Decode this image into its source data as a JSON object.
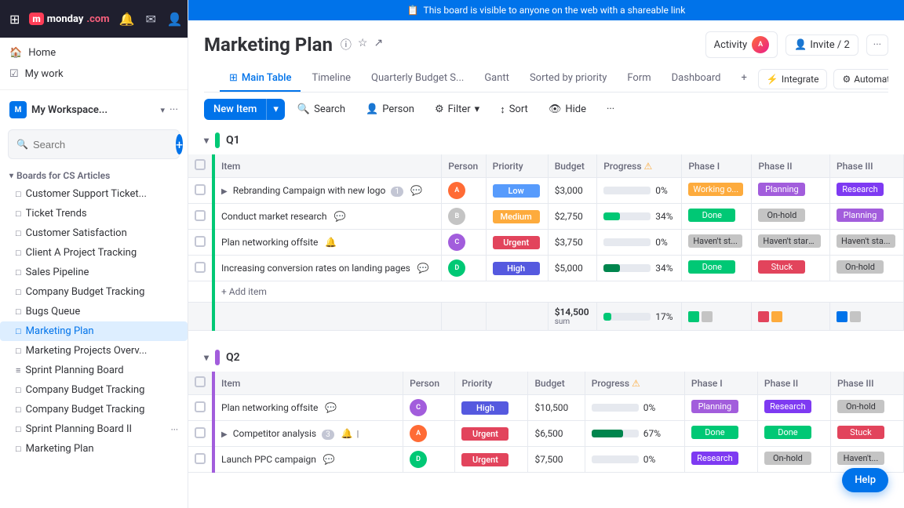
{
  "app": {
    "logo": "monday",
    "logo_short": "M",
    "top_nav_icons": [
      "grid-icon",
      "bell-icon",
      "message-icon",
      "person-icon",
      "diamond-icon",
      "lock-icon",
      "search-icon",
      "help-icon"
    ]
  },
  "sidebar": {
    "home_label": "Home",
    "mywork_label": "My work",
    "workspace_name": "My Workspace...",
    "search_placeholder": "Search",
    "boards_section_label": "Boards for CS Articles",
    "boards": [
      {
        "label": "Customer Support Ticket...",
        "active": false,
        "icon": "□"
      },
      {
        "label": "Ticket Trends",
        "active": false,
        "icon": "□"
      },
      {
        "label": "Customer Satisfaction",
        "active": false,
        "icon": "□"
      },
      {
        "label": "Client A Project Tracking",
        "active": false,
        "icon": "□"
      },
      {
        "label": "Sales Pipeline",
        "active": false,
        "icon": "□"
      },
      {
        "label": "Company Budget Tracking",
        "active": false,
        "icon": "□"
      },
      {
        "label": "Bugs Queue",
        "active": false,
        "icon": "□"
      },
      {
        "label": "Marketing Plan",
        "active": true,
        "icon": "□"
      },
      {
        "label": "Marketing Projects Overv...",
        "active": false,
        "icon": "□"
      },
      {
        "label": "Sprint Planning Board",
        "active": false,
        "icon": "≡"
      },
      {
        "label": "Company Budget Tracking",
        "active": false,
        "icon": "□"
      },
      {
        "label": "Company Budget Tracking",
        "active": false,
        "icon": "□"
      },
      {
        "label": "Sprint Planning Board II",
        "active": false,
        "icon": "□"
      },
      {
        "label": "Marketing Plan",
        "active": false,
        "icon": "□"
      }
    ]
  },
  "banner": {
    "icon": "📋",
    "text": "This board is visible to anyone on the web with a shareable link"
  },
  "board": {
    "title": "Marketing Plan",
    "activity_label": "Activity",
    "invite_label": "Invite / 2",
    "tabs": [
      {
        "label": "Main Table",
        "icon": "⊞",
        "active": true
      },
      {
        "label": "Timeline",
        "icon": "",
        "active": false
      },
      {
        "label": "Quarterly Budget S...",
        "icon": "",
        "active": false
      },
      {
        "label": "Gantt",
        "icon": "",
        "active": false
      },
      {
        "label": "Sorted by priority",
        "icon": "",
        "active": false
      },
      {
        "label": "Form",
        "icon": "",
        "active": false
      },
      {
        "label": "Dashboard",
        "icon": "",
        "active": false
      },
      {
        "label": "+",
        "icon": "",
        "active": false
      }
    ],
    "integrate_label": "Integrate",
    "automate_label": "Automate"
  },
  "toolbar": {
    "new_item_label": "New Item",
    "search_label": "Search",
    "person_label": "Person",
    "filter_label": "Filter",
    "sort_label": "Sort",
    "hide_label": "Hide"
  },
  "q1": {
    "label": "Q1",
    "columns": [
      "Item",
      "Person",
      "Priority",
      "Budget",
      "Progress",
      "!",
      "Phase I",
      "Phase II",
      "Phase III"
    ],
    "rows": [
      {
        "item": "Rebranding Campaign with new logo",
        "badge": "1",
        "person_color": "#ff6b35",
        "priority": "Low",
        "priority_class": "priority-low",
        "budget": "$3,000",
        "progress": 0,
        "phase1": "Working o...",
        "phase1_class": "phase-working",
        "phase2": "Planning",
        "phase2_class": "phase-planning",
        "phase3": "Research",
        "phase3_class": "phase-research",
        "has_expand": true
      },
      {
        "item": "Conduct market research",
        "badge": "",
        "person_color": "#c4c4c4",
        "priority": "Medium",
        "priority_class": "priority-medium",
        "budget": "$2,750",
        "progress": 34,
        "phase1": "Done",
        "phase1_class": "phase-done",
        "phase2": "On-hold",
        "phase2_class": "phase-onhold",
        "phase3": "Planning",
        "phase3_class": "phase-planning",
        "has_expand": false
      },
      {
        "item": "Plan networking offsite",
        "badge": "",
        "person_color": "#a25ddc",
        "priority": "Urgent",
        "priority_class": "priority-urgent",
        "budget": "$3,750",
        "progress": 0,
        "phase1": "Haven't st...",
        "phase1_class": "phase-havent",
        "phase2": "Haven't start...",
        "phase2_class": "phase-havent",
        "phase3": "Haven't sta...",
        "phase3_class": "phase-havent",
        "has_expand": false
      },
      {
        "item": "Increasing conversion rates on landing pages",
        "badge": "",
        "person_color": "#00c875",
        "priority": "High",
        "priority_class": "priority-high",
        "budget": "$5,000",
        "progress": 34,
        "phase1": "Done",
        "phase1_class": "phase-done",
        "phase2": "Stuck",
        "phase2_class": "phase-stuck",
        "phase3": "On-hold",
        "phase3_class": "phase-onhold",
        "has_expand": false
      }
    ],
    "footer": {
      "budget_total": "$14,500",
      "budget_label": "sum",
      "progress": 17,
      "swatches": [
        "#00c875",
        "#c4c4c4",
        "#e2445c",
        "#fdab3d",
        "#579bfc",
        "#a25ddc",
        "#0073ea",
        "#c4c4c4"
      ]
    }
  },
  "q2": {
    "label": "Q2",
    "columns": [
      "Item",
      "Person",
      "Priority",
      "Budget",
      "Progress",
      "!",
      "Phase I",
      "Phase II",
      "Phase III"
    ],
    "rows": [
      {
        "item": "Plan networking offsite",
        "person_color": "#a25ddc",
        "priority": "High",
        "priority_class": "priority-high",
        "budget": "$10,500",
        "progress": 0,
        "phase1": "Planning",
        "phase1_class": "phase-planning",
        "phase2": "Research",
        "phase2_class": "phase-research",
        "phase3": "On-hold",
        "phase3_class": "phase-onhold",
        "has_expand": false
      },
      {
        "item": "Competitor analysis",
        "badge": "3",
        "person_color": "#ff6b35",
        "priority": "Urgent",
        "priority_class": "priority-urgent",
        "budget": "$6,500",
        "progress": 67,
        "phase1": "Done",
        "phase1_class": "phase-done",
        "phase2": "Done",
        "phase2_class": "phase-done",
        "phase3": "Stuck",
        "phase3_class": "phase-stuck",
        "has_expand": true
      },
      {
        "item": "Launch PPC campaign",
        "person_color": "#00c875",
        "priority": "Urgent",
        "priority_class": "priority-urgent",
        "budget": "$7,500",
        "progress": 0,
        "phase1": "Research",
        "phase1_class": "phase-research",
        "phase2": "On-hold",
        "phase2_class": "phase-onhold",
        "phase3": "Haven't...",
        "phase3_class": "phase-havent",
        "has_expand": false
      }
    ]
  },
  "help": {
    "label": "Help"
  }
}
